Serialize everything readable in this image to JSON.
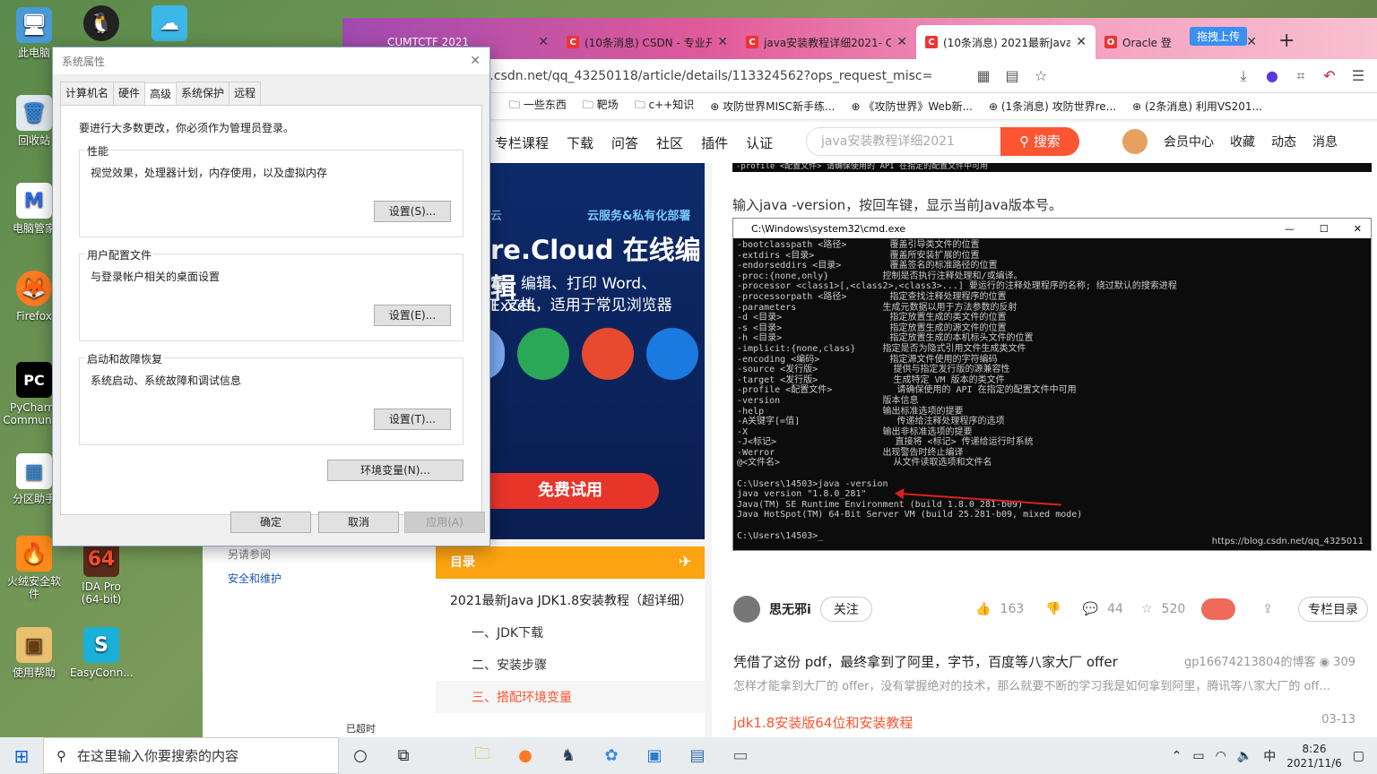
{
  "desktop": {
    "icons": [
      {
        "label": "此电脑",
        "glyph": "🖥"
      },
      {
        "label": "回收站",
        "glyph": "🗑"
      },
      {
        "label": "电脑管家",
        "glyph": "M"
      },
      {
        "label": "Firefox",
        "glyph": "🦊"
      },
      {
        "label": "PyCharm Community",
        "glyph": "PC"
      },
      {
        "label": "分区助手",
        "glyph": "▦"
      },
      {
        "label": "火绒安全软件",
        "glyph": "🔥"
      },
      {
        "label": "使用帮助",
        "glyph": "▣"
      },
      {
        "label": "IDA Pro (64-bit)",
        "glyph": "64"
      },
      {
        "label": "EasyConn...",
        "glyph": "S"
      }
    ]
  },
  "browser": {
    "tabs": [
      {
        "title": "CUMTCTF 2021",
        "icon": ""
      },
      {
        "title": "(10条消息) CSDN - 专业开",
        "icon": "C"
      },
      {
        "title": "java安装教程详细2021- CS",
        "icon": "C"
      },
      {
        "title": "(10条消息) 2021最新Java J",
        "icon": "C"
      },
      {
        "title": "Oracle 登",
        "icon": "O"
      }
    ],
    "upload_label": "拖拽上传",
    "url": "https://blog.csdn.net/qq_43250118/article/details/113324562?ops_request_misc=",
    "bookmarks": [
      "一些东西",
      "靶场",
      "c++知识",
      "攻防世界MISC新手练...",
      "《攻防世界》Web新...",
      "(1条消息) 攻防世界re...",
      "(2条消息) 利用VS201..."
    ],
    "nav": [
      "专栏课程",
      "下载",
      "问答",
      "社区",
      "插件",
      "认证"
    ],
    "search_placeholder": "java安装教程详细2021",
    "search_btn": "搜索",
    "nav_right": [
      "会员中心",
      "收藏",
      "动态",
      "消息"
    ]
  },
  "ad": {
    "tagline_left": "云",
    "tagline_right": "云服务&私有化部署",
    "headline": "re.Cloud 在线编辑",
    "line2": "看、编辑、打印 Word、Excel、",
    "line3": "T 文档，适用于常见浏览器",
    "cta": "免费试用"
  },
  "toc": {
    "header": "目录",
    "title": "2021最新Java JDK1.8安装教程（超详细）",
    "items": [
      "一、JDK下载",
      "二、安装步骤",
      "三、搭配环境变量"
    ]
  },
  "article": {
    "top_strip": "-profile <配置文件>           请确保使用的 API 在指定的配置文件中可用",
    "instruction": "输入java -version，按回车键，显示当前Java版本号。",
    "cmd_title": "C:\\Windows\\system32\\cmd.exe",
    "cmd_output": "-bootclasspath <路径>        覆盖引导类文件的位置\n-extdirs <目录>              覆盖所安装扩展的位置\n-endorseddirs <目录>         覆盖签名的标准路径的位置\n-proc:{none,only}          控制是否执行注释处理和/或编译。\n-processor <class1>[,<class2>,<class3>...] 要运行的注释处理程序的名称; 绕过默认的搜索进程\n-processorpath <路径>        指定查找注释处理程序的位置\n-parameters                生成元数据以用于方法参数的反射\n-d <目录>                    指定放置生成的类文件的位置\n-s <目录>                    指定放置生成的源文件的位置\n-h <目录>                    指定放置生成的本机标头文件的位置\n-implicit:{none,class}     指定是否为隐式引用文件生成类文件\n-encoding <编码>             指定源文件使用的字符编码\n-source <发行版>              提供与指定发行版的源兼容性\n-target <发行版>              生成特定 VM 版本的类文件\n-profile <配置文件>            请确保使用的 API 在指定的配置文件中可用\n-version                   版本信息\n-help                      输出标准选项的提要\n-A关键字[=值]                  传递给注释处理程序的选项\n-X                         输出非标准选项的提要\n-J<标记>                      直接将 <标记> 传递给运行时系统\n-Werror                    出现警告时终止编译\n@<文件名>                     从文件读取选项和文件名\n\nC:\\Users\\14503>java -version\njava version \"1.8.0_281\"\nJava(TM) SE Runtime Environment (build 1.8.0_281-b09)\nJava HotSpot(TM) 64-Bit Server VM (build 25.281-b09, mixed mode)\n\nC:\\Users\\14503>_",
    "watermark": "https://blog.csdn.net/qq_4325011",
    "author": "思无邪i",
    "follow": "关注",
    "likes": "163",
    "comments": "44",
    "stars": "520",
    "column_dir": "专栏目录"
  },
  "recommend": [
    {
      "title": "凭借了这份 pdf，最终拿到了阿里，字节，百度等八家大厂 offer",
      "source": "gp16674213804的博客",
      "views": "309",
      "desc": "怎样才能拿到大厂的 offer，没有掌握绝对的技术，那么就要不断的学习我是如何拿到阿里，腾讯等八家大厂的 off..."
    },
    {
      "title": "jdk1.8安装版64位和安装教程",
      "date": "03-13"
    }
  ],
  "overtime": "已超时",
  "control_panel": {
    "see_also": "另请参阅",
    "security": "安全和维护"
  },
  "dialog": {
    "title": "系统属性",
    "tabs": [
      "计算机名",
      "硬件",
      "高级",
      "系统保护",
      "远程"
    ],
    "note": "要进行大多数更改，你必须作为管理员登录。",
    "groups": [
      {
        "label": "性能",
        "desc": "视觉效果，处理器计划，内存使用，以及虚拟内存",
        "button": "设置(S)..."
      },
      {
        "label": "用户配置文件",
        "desc": "与登录帐户相关的桌面设置",
        "button": "设置(E)..."
      },
      {
        "label": "启动和故障恢复",
        "desc": "系统启动、系统故障和调试信息",
        "button": "设置(T)..."
      }
    ],
    "env_button": "环境变量(N)...",
    "ok": "确定",
    "cancel": "取消",
    "apply": "应用(A)"
  },
  "taskbar": {
    "search_placeholder": "在这里输入你要搜索的内容",
    "time": "8:26",
    "date": "2021/11/6",
    "ime": "中"
  }
}
